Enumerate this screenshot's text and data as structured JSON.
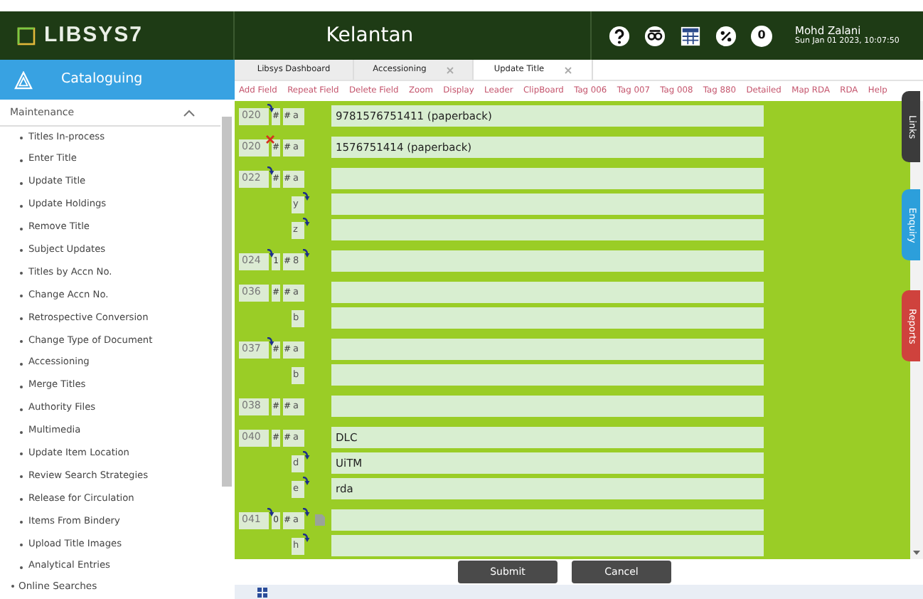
{
  "header": {
    "logo": "LIBSYS7",
    "title": "Kelantan",
    "notifications": "0",
    "user": "Mohd Zalani",
    "datetime": "Sun Jan 01 2023, 10:07:50"
  },
  "sidebar": {
    "module": "Cataloguing",
    "section": {
      "label": "Maintenance",
      "expanded": true,
      "items": [
        "Titles In-process",
        "Enter Title",
        "Update Title",
        "Update Holdings",
        "Remove Title",
        "Subject Updates",
        "Titles by Accn No.",
        "Change Accn No.",
        "Retrospective Conversion",
        "Change Type of Document",
        "Accessioning",
        "Merge Titles",
        "Authority Files",
        "Multimedia",
        "Update Item Location",
        "Review Search Strategies",
        "Release for Circulation",
        "Items From Bindery",
        "Upload Title Images",
        "Analytical Entries"
      ]
    },
    "next_section": "Online Searches"
  },
  "tabs": [
    {
      "label": "Libsys Dashboard",
      "closable": false,
      "selected": false
    },
    {
      "label": "Accessioning",
      "closable": true,
      "selected": false
    },
    {
      "label": "Update Title",
      "closable": true,
      "selected": true
    }
  ],
  "toolbar": [
    "Add Field",
    "Repeat Field",
    "Delete Field",
    "Zoom",
    "Display",
    "Leader",
    "ClipBoard",
    "Tag 006",
    "Tag 007",
    "Tag 008",
    "Tag 880",
    "Detailed",
    "Map RDA",
    "RDA",
    "Help"
  ],
  "fields": [
    {
      "tag": "020",
      "repeat": true,
      "deleted": false,
      "document": false,
      "ind1": "#",
      "ind2": "#",
      "subfields": [
        {
          "code": "a",
          "repeat": false,
          "value": "9781576751411 (paperback)"
        }
      ]
    },
    {
      "tag": "020",
      "repeat": false,
      "deleted": true,
      "document": false,
      "ind1": "#",
      "ind2": "#",
      "subfields": [
        {
          "code": "a",
          "repeat": false,
          "value": "1576751414 (paperback)"
        }
      ]
    },
    {
      "tag": "022",
      "repeat": true,
      "deleted": false,
      "document": false,
      "ind1": "#",
      "ind2": "#",
      "subfields": [
        {
          "code": "a",
          "repeat": false
        },
        {
          "code": "y",
          "repeat": true
        },
        {
          "code": "z",
          "repeat": true
        }
      ]
    },
    {
      "tag": "024",
      "repeat": true,
      "deleted": false,
      "document": false,
      "ind1": "1",
      "ind2": "#",
      "subfields": [
        {
          "code": "8",
          "repeat": true
        }
      ]
    },
    {
      "tag": "036",
      "repeat": false,
      "deleted": false,
      "document": false,
      "ind1": "#",
      "ind2": "#",
      "subfields": [
        {
          "code": "a",
          "repeat": false
        },
        {
          "code": "b",
          "repeat": false
        }
      ]
    },
    {
      "tag": "037",
      "repeat": true,
      "deleted": false,
      "document": false,
      "ind1": "#",
      "ind2": "#",
      "subfields": [
        {
          "code": "a",
          "repeat": false
        },
        {
          "code": "b",
          "repeat": false
        }
      ]
    },
    {
      "tag": "038",
      "repeat": false,
      "deleted": false,
      "document": false,
      "ind1": "#",
      "ind2": "#",
      "subfields": [
        {
          "code": "a",
          "repeat": false
        }
      ]
    },
    {
      "tag": "040",
      "repeat": false,
      "deleted": false,
      "document": false,
      "ind1": "#",
      "ind2": "#",
      "subfields": [
        {
          "code": "a",
          "repeat": false,
          "value": "DLC"
        },
        {
          "code": "d",
          "repeat": true,
          "value": "UiTM"
        },
        {
          "code": "e",
          "repeat": true,
          "value": "rda"
        }
      ]
    },
    {
      "tag": "041",
      "repeat": true,
      "deleted": false,
      "document": true,
      "ind1": "0",
      "ind2": "#",
      "subfields": [
        {
          "code": "a",
          "repeat": true
        },
        {
          "code": "h",
          "repeat": true
        }
      ]
    }
  ],
  "buttons": [
    "Submit",
    "Cancel"
  ],
  "side_tabs": [
    {
      "label": "Links",
      "color": "#3b3b3b"
    },
    {
      "label": "Enquiry",
      "color": "#2c9fdb"
    },
    {
      "label": "Reports",
      "color": "#cf423d"
    }
  ]
}
